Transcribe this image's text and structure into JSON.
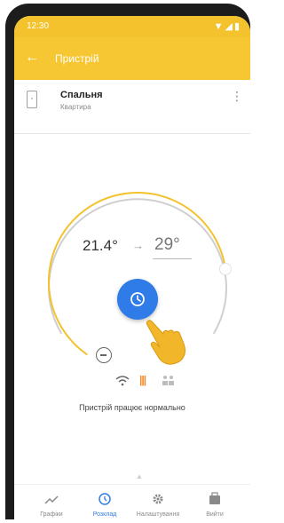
{
  "status_bar": {
    "time": "12:30",
    "icons": [
      "wifi-icon",
      "signal-icon",
      "battery-icon"
    ]
  },
  "app_bar": {
    "back_icon": "arrow-left-icon",
    "title": "Пристрій"
  },
  "device": {
    "name": "Спальня",
    "room": "Квартира",
    "icon": "thermostat-icon",
    "menu_icon": "more-vertical-icon"
  },
  "thermostat": {
    "current_temp": "21.4°",
    "arrow": "→",
    "target_temp": "29°",
    "dial_fraction": 0.78,
    "center_button_icon": "clock-icon",
    "minus_icon": "minus-circle-icon"
  },
  "modes": {
    "icons": [
      "wifi-icon",
      "heating-icon",
      "people-icon"
    ],
    "heat_glyph": "||| "
  },
  "status_text": "Пристрій працює нормально",
  "bottom_nav": [
    {
      "label": "Графіки",
      "icon": "chart-icon",
      "active": false
    },
    {
      "label": "Розклад",
      "icon": "clock-icon",
      "active": true
    },
    {
      "label": "Налаштування",
      "icon": "gear-icon",
      "active": false
    },
    {
      "label": "Вийти",
      "icon": "briefcase-icon",
      "active": false
    }
  ],
  "colors": {
    "accent": "#f6c633",
    "primary": "#2f7ce8",
    "arc": "#f3c22c",
    "arc_track": "#cfcfcf",
    "heat": "#f08a2a"
  }
}
